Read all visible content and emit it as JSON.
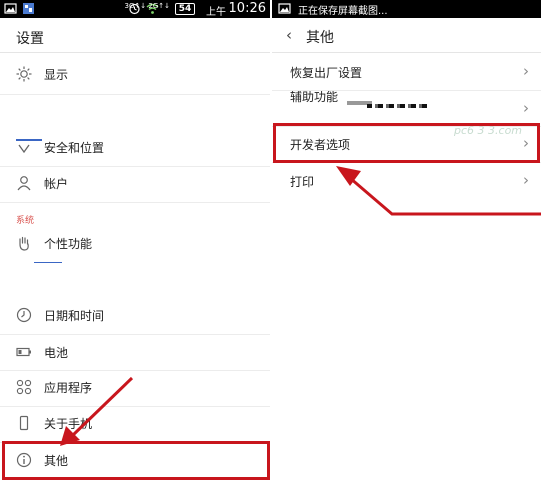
{
  "left": {
    "status_bar": {
      "time": "10:26",
      "ampm": "上午",
      "battery": "54",
      "signal": "3G↑↓ 2G↑↓"
    },
    "title": "设置",
    "section_label": "系统",
    "items": [
      {
        "label": "显示",
        "icon": "brightness-icon"
      },
      {
        "label": "安全和位置",
        "icon": "shield-icon"
      },
      {
        "label": "帐户",
        "icon": "person-icon"
      },
      {
        "label": "个性功能",
        "icon": "hand-icon"
      },
      {
        "label": "日期和时间",
        "icon": "clock-icon"
      },
      {
        "label": "电池",
        "icon": "battery-icon"
      },
      {
        "label": "应用程序",
        "icon": "apps-grid-icon"
      },
      {
        "label": "关于手机",
        "icon": "phone-icon"
      },
      {
        "label": "其他",
        "icon": "info-icon"
      }
    ]
  },
  "right": {
    "status_bar": {
      "notification": "正在保存屏幕截图..."
    },
    "back": "‹",
    "title": "其他",
    "items": [
      {
        "label": "恢复出厂设置"
      },
      {
        "label": "辅助功能"
      },
      {
        "label": "开发者选项"
      },
      {
        "label": "打印"
      }
    ],
    "chevron": "›",
    "watermark": "pc6 3 3.com"
  },
  "annotation_color": "#c8161d"
}
